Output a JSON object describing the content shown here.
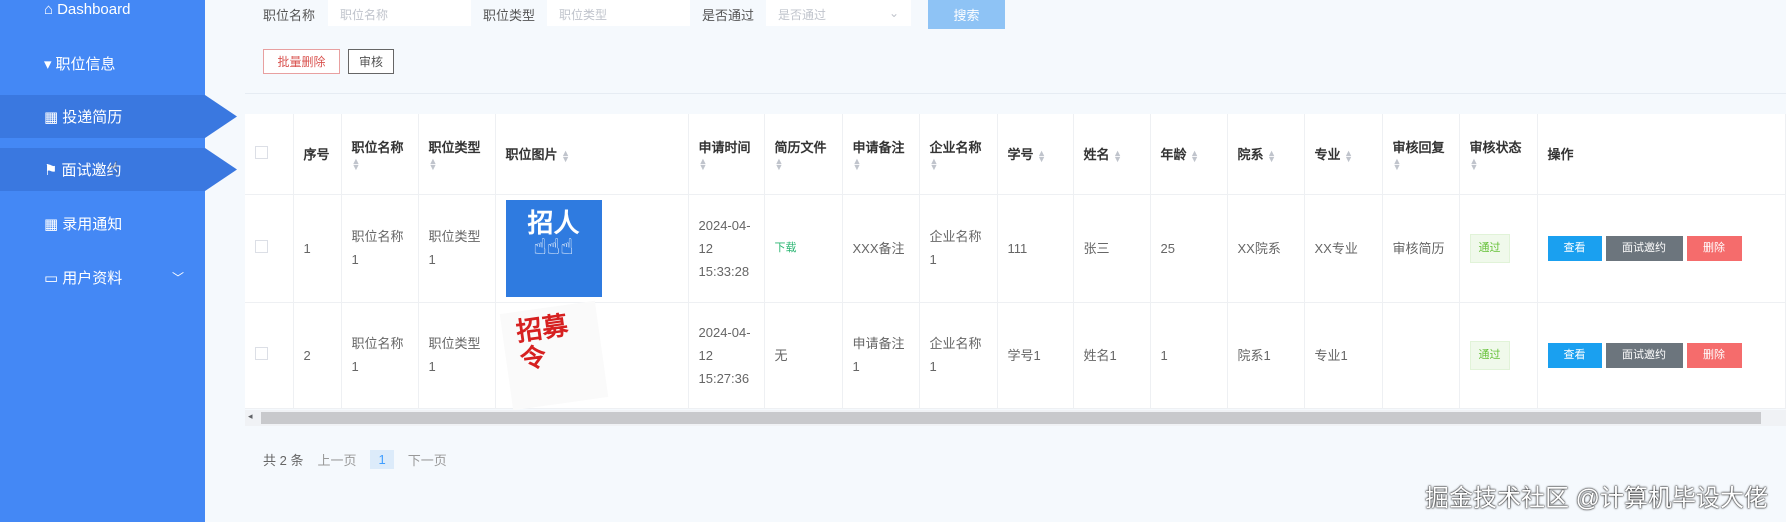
{
  "sidebar": {
    "items": [
      {
        "icon": "home-icon",
        "glyph": "⌂",
        "label": "Dashboard"
      },
      {
        "icon": "tag-icon",
        "glyph": "▾",
        "label": "职位信息"
      },
      {
        "icon": "grid-icon",
        "glyph": "▦",
        "label": "投递简历"
      },
      {
        "icon": "flag-icon",
        "glyph": "⚑",
        "label": "面试邀约"
      },
      {
        "icon": "grid-icon",
        "glyph": "▦",
        "label": "录用通知"
      },
      {
        "icon": "card-icon",
        "glyph": "▭",
        "label": "用户资料"
      }
    ]
  },
  "search": {
    "name_label": "职位名称",
    "name_placeholder": "职位名称",
    "type_label": "职位类型",
    "type_placeholder": "职位类型",
    "pass_label": "是否通过",
    "pass_placeholder": "是否通过",
    "search_button": "搜索"
  },
  "actions": {
    "batch_delete": "批量删除",
    "review": "审核"
  },
  "table": {
    "headers": [
      "序号",
      "职位名称",
      "职位类型",
      "职位图片",
      "申请时间",
      "简历文件",
      "申请备注",
      "企业名称",
      "学号",
      "姓名",
      "年龄",
      "院系",
      "专业",
      "审核回复",
      "审核状态",
      "操作"
    ],
    "rows": [
      {
        "index": "1",
        "job_name": "职位名称1",
        "job_type": "职位类型1",
        "image_text": "招人",
        "apply_time": "2024-04-12 15:33:28",
        "resume": "下载",
        "remark": "XXX备注",
        "company": "企业名称1",
        "student_no": "111",
        "name": "张三",
        "age": "25",
        "dept": "XX院系",
        "major": "XX专业",
        "reply": "审核简历",
        "status": "通过"
      },
      {
        "index": "2",
        "job_name": "职位名称1",
        "job_type": "职位类型1",
        "image_text": "招募令",
        "apply_time": "2024-04-12 15:27:36",
        "resume": "无",
        "remark": "申请备注1",
        "company": "企业名称1",
        "student_no": "学号1",
        "name": "姓名1",
        "age": "1",
        "dept": "院系1",
        "major": "专业1",
        "reply": "",
        "status": "通过"
      }
    ],
    "row_actions": {
      "view": "查看",
      "invite": "面试邀约",
      "delete": "删除"
    }
  },
  "pagination": {
    "total": "共 2 条",
    "prev": "上一页",
    "current": "1",
    "next": "下一页"
  },
  "watermark": "掘金技术社区 @计算机毕设大佬",
  "colors": {
    "sidebar": "#4488f5",
    "primary": "#1aa0f0",
    "gray": "#6c757d",
    "danger": "#f56c6c"
  }
}
